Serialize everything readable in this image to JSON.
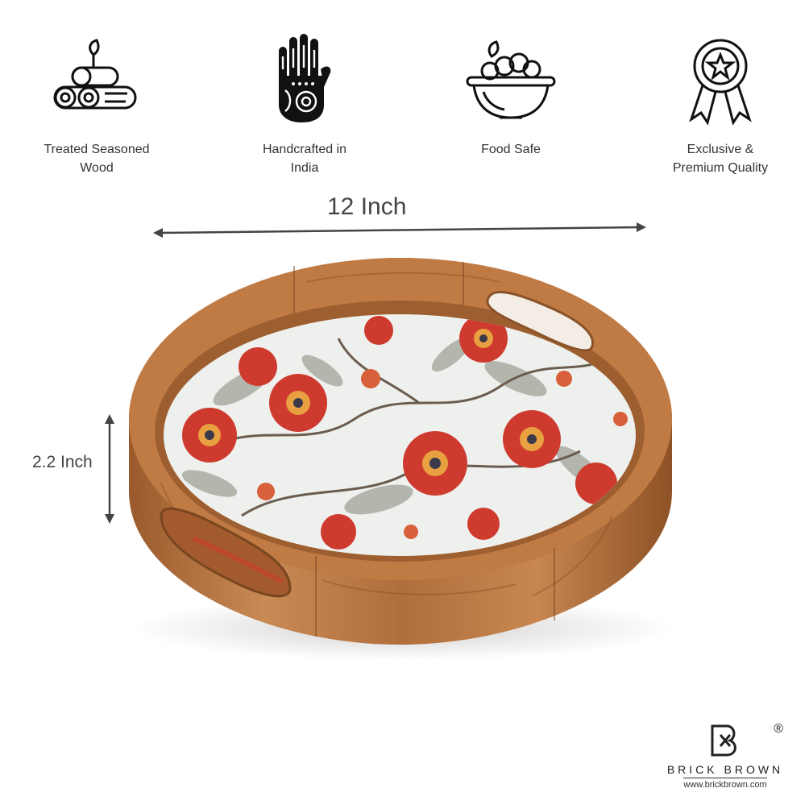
{
  "features": [
    {
      "icon": "wood-logs-icon",
      "line1": "Treated Seasoned",
      "line2": "Wood"
    },
    {
      "icon": "henna-hand-icon",
      "line1": "Handcrafted in",
      "line2": "India"
    },
    {
      "icon": "fruit-bowl-icon",
      "line1": "Food Safe",
      "line2": ""
    },
    {
      "icon": "award-badge-icon",
      "line1": "Exclusive &",
      "line2": "Premium Quality"
    }
  ],
  "dimensions": {
    "width": "12 Inch",
    "height": "2.2 Inch"
  },
  "product": {
    "name": "round wooden serving tray with floral print base"
  },
  "brand": {
    "name": "BRICK BROWN",
    "url": "www.brickbrown.com",
    "registered": "®"
  },
  "colors": {
    "wood": "#b9723f",
    "wood_dark": "#8a5228",
    "flower_red": "#cf3a2e",
    "leaf_gray": "#9a9e94",
    "text": "#333333"
  }
}
